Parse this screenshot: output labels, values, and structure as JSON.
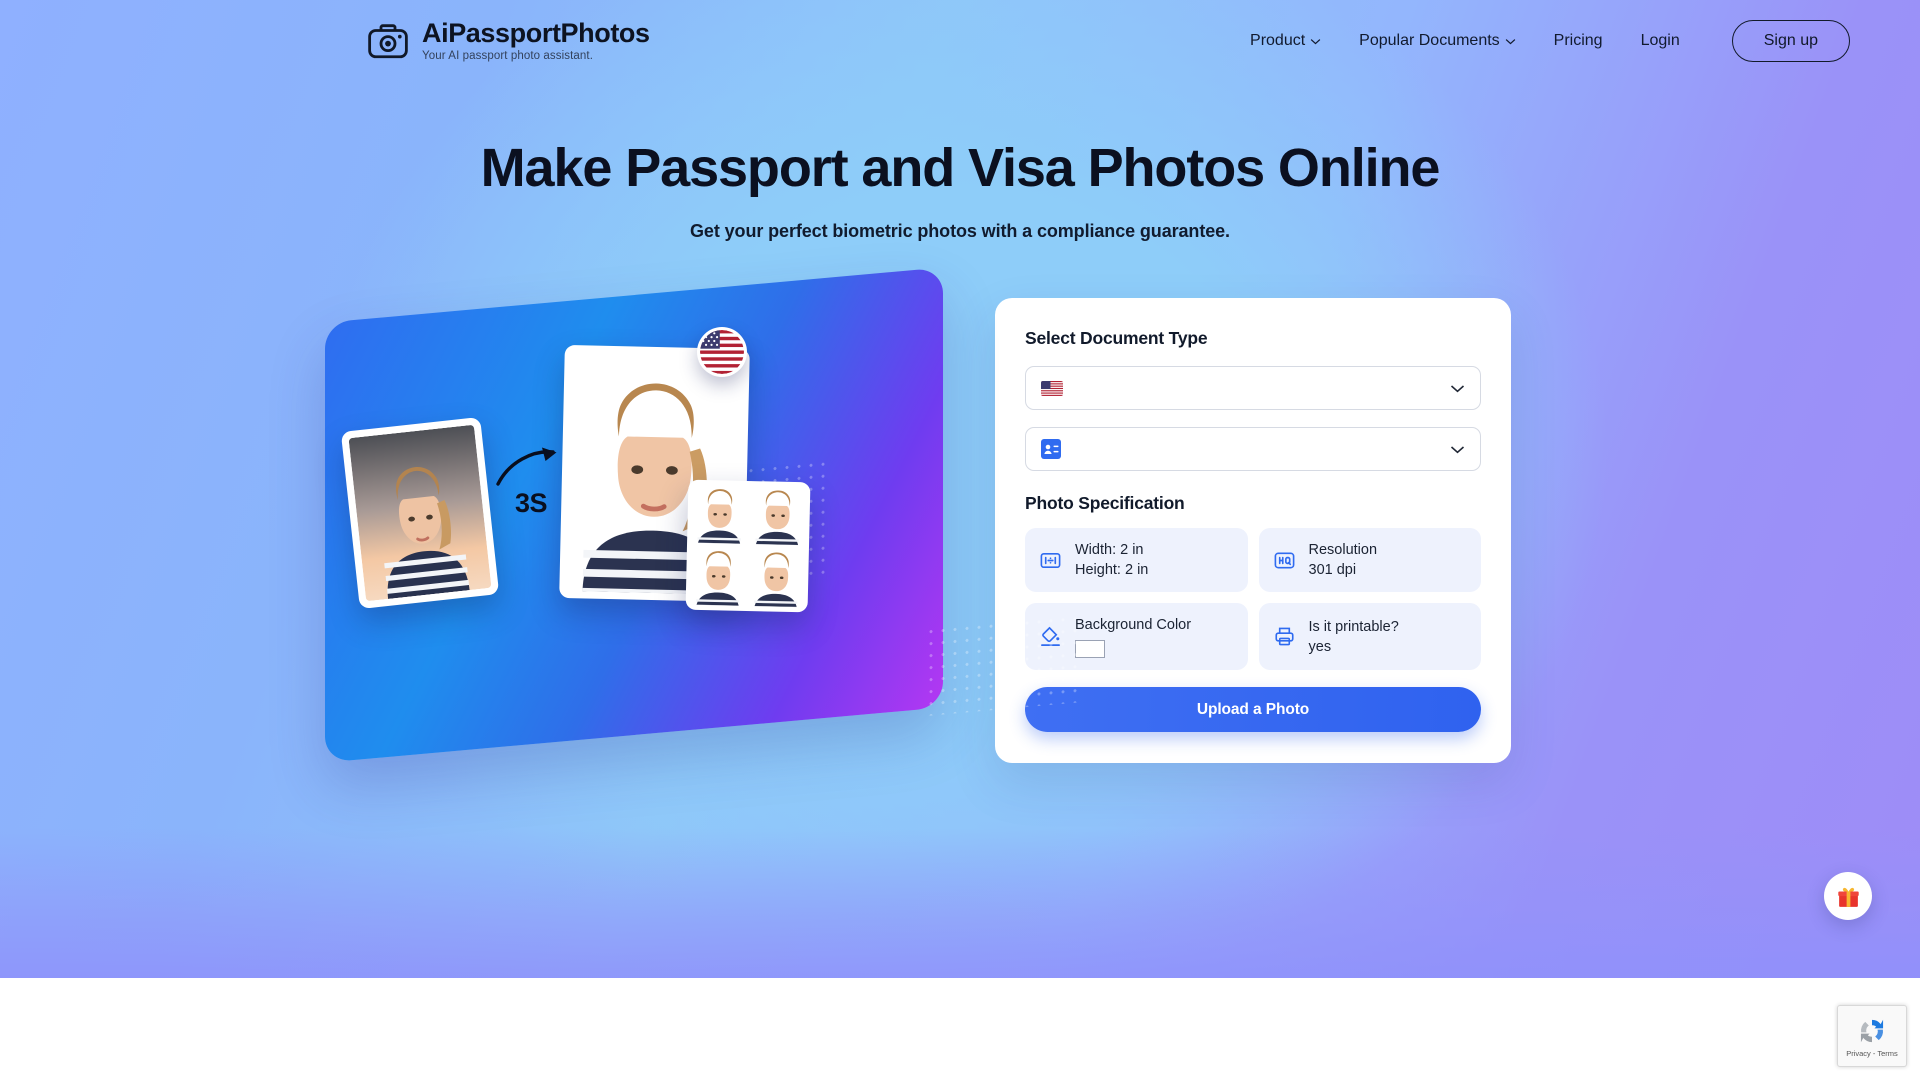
{
  "brand": {
    "name": "AiPassportPhotos",
    "tagline": "Your AI passport photo assistant.",
    "icon": "camera-icon"
  },
  "nav": {
    "items": [
      {
        "label": "Product",
        "has_caret": true
      },
      {
        "label": "Popular Documents",
        "has_caret": true
      },
      {
        "label": "Pricing",
        "has_caret": false
      },
      {
        "label": "Login",
        "has_caret": false
      }
    ],
    "signup_label": "Sign up"
  },
  "hero": {
    "headline": "Make Passport and Visa Photos Online",
    "subhead": "Get your perfect biometric photos with a compliance guarantee."
  },
  "illustration": {
    "seconds_label": "3S",
    "flag_badge": "us-flag-icon",
    "arrow": "curved-arrow-icon"
  },
  "form": {
    "title": "Select Document Type",
    "country_select": {
      "icon": "us-flag-icon",
      "value": ""
    },
    "doctype_select": {
      "icon": "id-card-icon",
      "value": ""
    },
    "spec_title": "Photo Specification",
    "specs": [
      {
        "icon": "dimensions-icon",
        "line1": "Width: 2 in",
        "line2": "Height: 2 in"
      },
      {
        "icon": "hq-icon",
        "line1": "Resolution",
        "line2": "301 dpi"
      },
      {
        "icon": "paint-bucket-icon",
        "line1": "Background Color",
        "line2": "",
        "swatch": "#ffffff"
      },
      {
        "icon": "printer-icon",
        "line1": "Is it printable?",
        "line2": "yes"
      }
    ],
    "upload_label": "Upload a Photo"
  },
  "floating": {
    "gift": "gift-icon",
    "recaptcha_text": "Privacy - Terms"
  },
  "colors": {
    "accent": "#2f62ef",
    "text": "#111a2b",
    "spec_bg": "#eef2fd",
    "hero_blue": "#8ecdf9",
    "hero_purple": "#9e8cf7"
  }
}
